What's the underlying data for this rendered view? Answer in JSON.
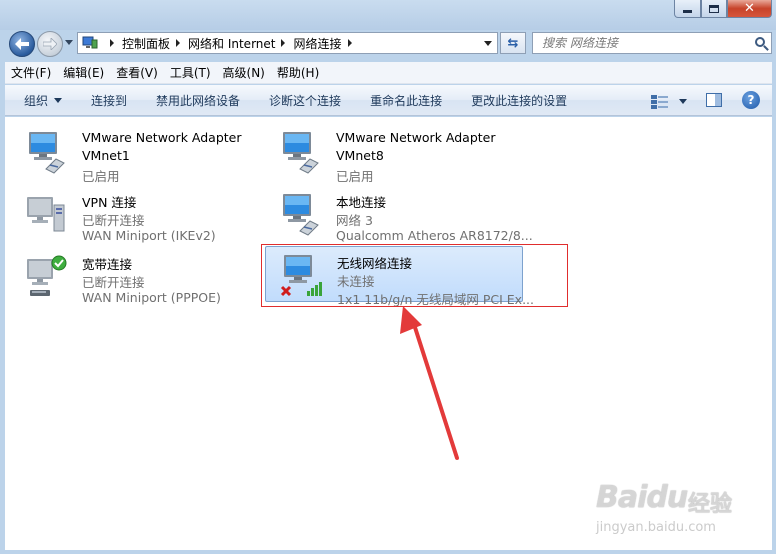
{
  "address": {
    "crumbs": [
      "控制面板",
      "网络和 Internet",
      "网络连接"
    ]
  },
  "search": {
    "placeholder": "搜索 网络连接"
  },
  "menu": [
    "文件(F)",
    "编辑(E)",
    "查看(V)",
    "工具(T)",
    "高级(N)",
    "帮助(H)"
  ],
  "commands": {
    "organize": "组织",
    "connect": "连接到",
    "disable": "禁用此网络设备",
    "diagnose": "诊断这个连接",
    "rename": "重命名此连接",
    "change": "更改此连接的设置"
  },
  "connections": [
    {
      "name": "VMware Network Adapter",
      "line2": "VMnet1",
      "line3": "已启用",
      "status": "enabled"
    },
    {
      "name": "VMware Network Adapter",
      "line2": "VMnet8",
      "line3": "已启用",
      "status": "enabled"
    },
    {
      "name": "VPN 连接",
      "line2": "已断开连接",
      "line3": "WAN Miniport (IKEv2)",
      "status": "disconnected"
    },
    {
      "name": "本地连接",
      "line2": "网络  3",
      "line3": "Qualcomm Atheros AR8172/8...",
      "status": "connected"
    },
    {
      "name": "宽带连接",
      "line2": "已断开连接",
      "line3": "WAN Miniport (PPPOE)",
      "status": "disconnected"
    },
    {
      "name": "无线网络连接",
      "line2": "未连接",
      "line3": "1x1 11b/g/n 无线局域网 PCI Ex...",
      "status": "not-connected",
      "selected": true
    }
  ],
  "watermark": {
    "brand": "Baidu",
    "suffix": "经验",
    "url": "jingyan.baidu.com"
  },
  "colors": {
    "highlight": "#e02d2d",
    "selection": "#c1dcfc",
    "link": "#1e395b"
  }
}
